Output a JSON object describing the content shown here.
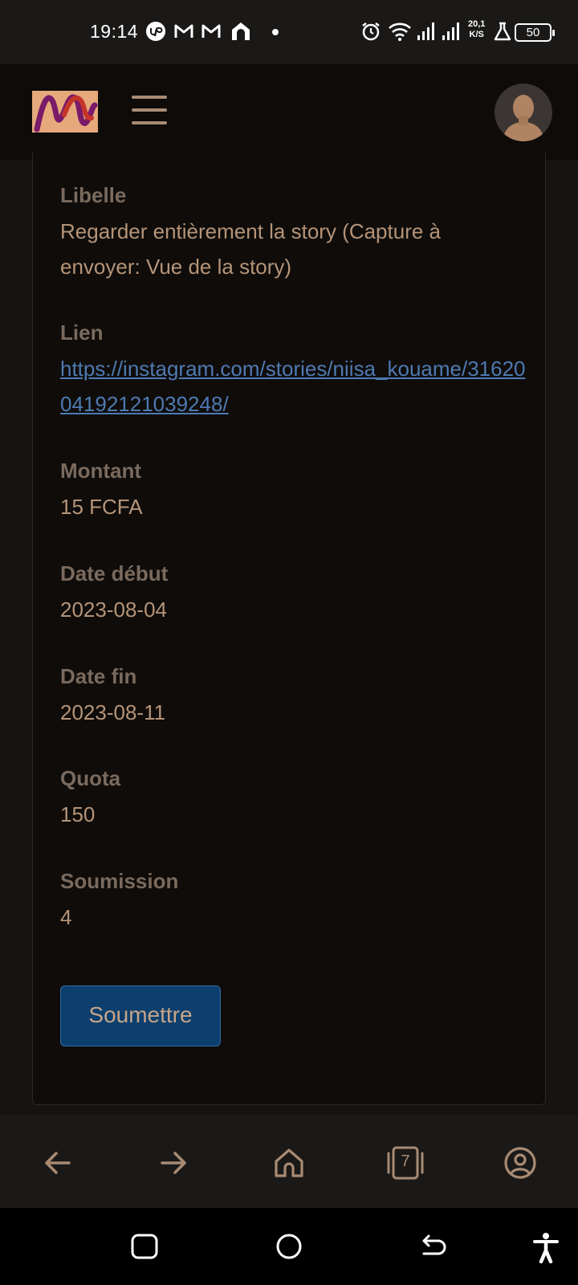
{
  "status_bar": {
    "time": "19:14",
    "net_speed_value": "20,1",
    "net_speed_unit": "K/S",
    "battery": "50",
    "icons": [
      "upwork-icon",
      "gmail-icon",
      "gmail-icon",
      "home-app-icon",
      "notification-dot",
      "alarm-icon",
      "wifi-icon",
      "signal-icon",
      "signal-icon",
      "lab-flask-icon",
      "battery-icon"
    ]
  },
  "header": {
    "logo": "app-logo",
    "menu_icon": "hamburger-menu-icon",
    "avatar": "user-avatar"
  },
  "details": {
    "libelle_label": "Libelle",
    "libelle_value": "Regarder entièrement la story (Capture à envoyer: Vue de la story)",
    "lien_label": "Lien",
    "lien_value": "https://instagram.com/stories/niisa_kouame/3162004192121039248/",
    "montant_label": "Montant",
    "montant_value": "15 FCFA",
    "date_debut_label": "Date début",
    "date_debut_value": "2023-08-04",
    "date_fin_label": "Date fin",
    "date_fin_value": "2023-08-11",
    "quota_label": "Quota",
    "quota_value": "150",
    "soumission_label": "Soumission",
    "soumission_value": "4",
    "submit_label": "Soumettre"
  },
  "browser_bar": {
    "tab_count": "7",
    "icons": [
      "back-arrow-icon",
      "forward-arrow-icon",
      "home-icon",
      "tabs-icon",
      "account-icon"
    ]
  },
  "colors": {
    "page_bg": "#161412",
    "card_bg": "#0f0c0a",
    "label": "#7a6a5d",
    "value": "#b59478",
    "link": "#4e7ab1",
    "button_bg": "#0c3f6d",
    "icon_tint": "#a88b74"
  }
}
